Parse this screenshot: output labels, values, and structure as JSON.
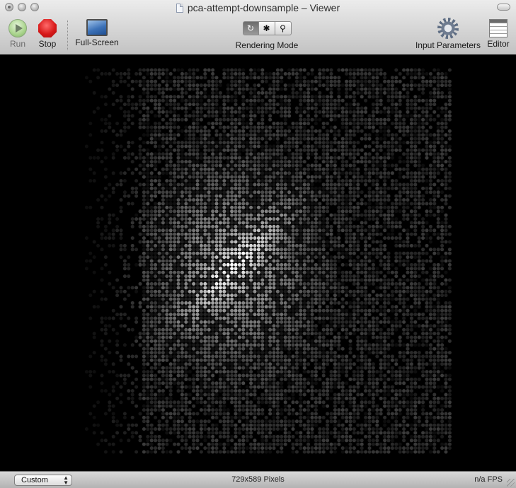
{
  "window": {
    "title": "pca-attempt-downsample – Viewer"
  },
  "toolbar": {
    "run_label": "Run",
    "stop_label": "Stop",
    "fullscreen_label": "Full-Screen",
    "rendering_mode_label": "Rendering Mode",
    "rendering_mode_options": [
      "refresh-icon",
      "bug-icon",
      "magnifier-icon"
    ],
    "rendering_mode_selected": 0,
    "input_parameters_label": "Input Parameters",
    "editor_label": "Editor"
  },
  "status_bar": {
    "size_popup_value": "Custom",
    "resolution": "729x589 Pixels",
    "fps": "n/a FPS"
  },
  "colors": {
    "run_disabled_text": "#6b6b6b",
    "stop_red": "#d81a1a",
    "canvas_bg": "#000000"
  }
}
